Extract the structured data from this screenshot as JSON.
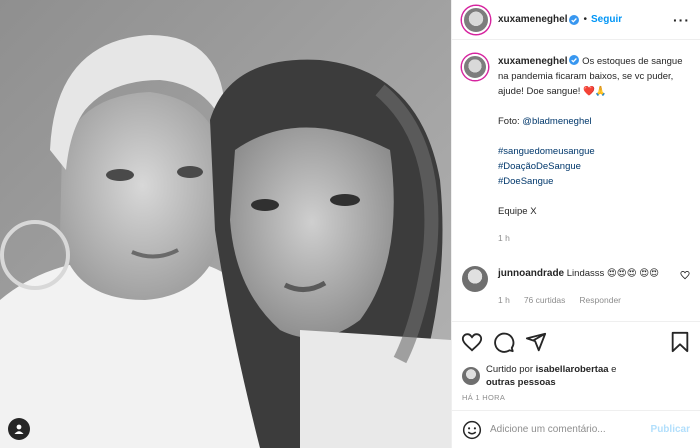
{
  "header": {
    "username": "xuxameneghel",
    "separator": "•",
    "follow_label": "Seguir",
    "more_label": "···"
  },
  "caption": {
    "username": "xuxameneghel",
    "line1": "Os estoques de sangue na pandemia ficaram baixos, se vc puder, ajude! Doe sangue! ❤️🙏",
    "photo_credit_prefix": "Foto: ",
    "photo_credit_handle": "@bladmeneghel",
    "hashtags": [
      "#sanguedomeusangue",
      "#DoaçãoDeSangue",
      "#DoeSangue"
    ],
    "signature": "Equipe X",
    "time": "1 h"
  },
  "comment": {
    "username": "junnoandrade",
    "text": "Lindasss 😍😍😍 😍😍",
    "time": "1 h",
    "likes": "76 curtidas",
    "reply_label": "Responder"
  },
  "likes_row": {
    "prefix": "Curtido por ",
    "user": "isabellarobertaa",
    "middle": " e",
    "rest": "outras pessoas"
  },
  "timestamp": "HÁ 1 HORA",
  "add_comment": {
    "placeholder": "Adicione um comentário...",
    "publish_label": "Publicar"
  },
  "icons": {
    "like": "heart-icon",
    "comment": "comment-icon",
    "share": "share-icon",
    "save": "bookmark-icon",
    "emoji": "emoji-icon",
    "tag": "user-tag-icon",
    "verified": "verified-badge-icon"
  },
  "colors": {
    "follow": "#0095f6",
    "link": "#00376b",
    "muted": "#8e8e8e",
    "publish_disabled": "#b2dffc"
  }
}
